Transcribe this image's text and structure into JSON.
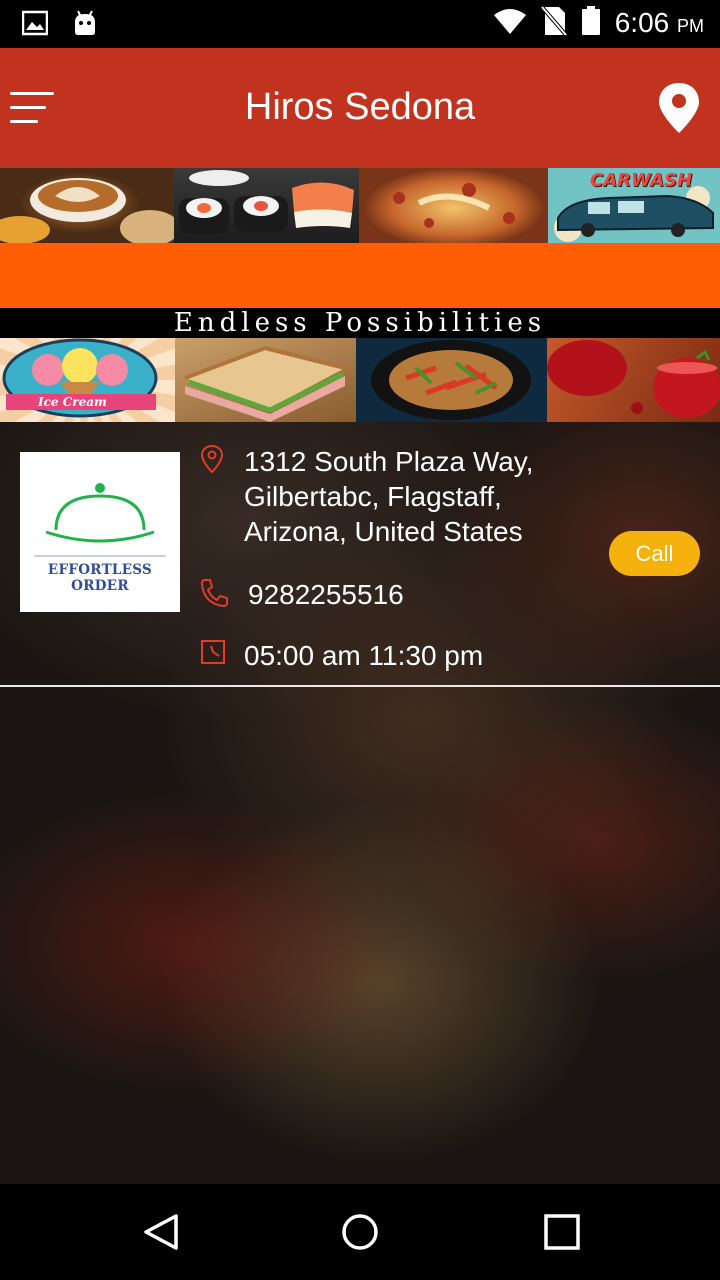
{
  "status_bar": {
    "time": "6:06",
    "ampm": "PM",
    "icons": [
      "gallery-icon",
      "android-icon",
      "wifi-icon",
      "no-sim-icon",
      "battery-icon"
    ]
  },
  "app_bar": {
    "title": "Hiros Sedona",
    "menu_icon": "hamburger-menu-icon",
    "location_icon": "location-pin-icon"
  },
  "banner": {
    "top_images": [
      "latte-art",
      "sushi-rolls",
      "pizza",
      "car-wash-sign"
    ],
    "car_wash_text": "CARWASH",
    "tagline": "Endless Possibilities",
    "bottom_images": [
      "ice-cream-sign",
      "sandwich",
      "stir-fry-noodles",
      "red-smoothie"
    ],
    "ice_cream_text": "Ice Cream"
  },
  "business": {
    "logo_text": "EFFORTLESS ORDER",
    "address_lines": [
      "1312 South Plaza Way,",
      "Gilbertabc, Flagstaff,",
      "Arizona, United States"
    ],
    "phone": "9282255516",
    "hours": "05:00 am 11:30 pm",
    "call_label": "Call"
  },
  "colors": {
    "app_bar": "#c1321f",
    "orange_band": "#ff5d06",
    "call_button": "#f6b10c",
    "icon_red": "#e23b2a",
    "logo_blue": "#2d4c9a",
    "logo_green": "#21b24b"
  },
  "nav_bar": {
    "icons": [
      "back-icon",
      "home-icon",
      "recents-icon"
    ]
  }
}
